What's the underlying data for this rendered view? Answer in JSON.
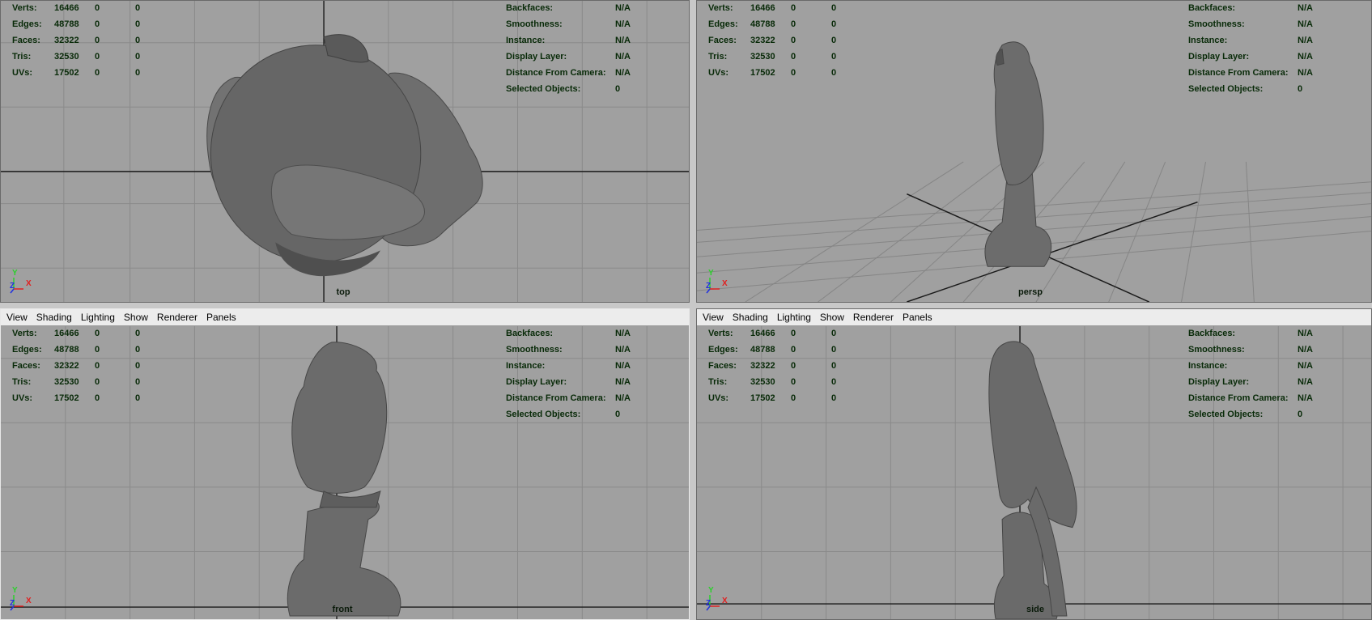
{
  "menu": [
    "View",
    "Shading",
    "Lighting",
    "Show",
    "Renderer",
    "Panels"
  ],
  "hud": {
    "stats": [
      {
        "label": "Verts:",
        "value": "16466",
        "a": "0",
        "b": "0"
      },
      {
        "label": "Edges:",
        "value": "48788",
        "a": "0",
        "b": "0"
      },
      {
        "label": "Faces:",
        "value": "32322",
        "a": "0",
        "b": "0"
      },
      {
        "label": "Tris:",
        "value": "32530",
        "a": "0",
        "b": "0"
      },
      {
        "label": "UVs:",
        "value": "17502",
        "a": "0",
        "b": "0"
      }
    ],
    "info": [
      {
        "label": "Backfaces:",
        "value": "N/A"
      },
      {
        "label": "Smoothness:",
        "value": "N/A"
      },
      {
        "label": "Instance:",
        "value": "N/A"
      },
      {
        "label": "Display Layer:",
        "value": "N/A"
      },
      {
        "label": "Distance From Camera:",
        "value": "N/A"
      },
      {
        "label": "Selected Objects:",
        "value": "0"
      }
    ]
  },
  "axis": {
    "y": "Y",
    "z": "Z",
    "x": "X"
  },
  "viewports": {
    "top": {
      "camera": "top"
    },
    "persp": {
      "camera": "persp"
    },
    "front": {
      "camera": "front"
    },
    "side": {
      "camera": "side"
    }
  },
  "colors": {
    "viewport_bg": "#a0a0a0",
    "grid": "#8a8a8a",
    "axis_line": "#1a1a1a",
    "mesh": "#6a6a6a",
    "hud_text": "#082a08",
    "axis_y": "#2ad02a",
    "axis_x": "#e02020",
    "axis_z": "#2030e0"
  }
}
